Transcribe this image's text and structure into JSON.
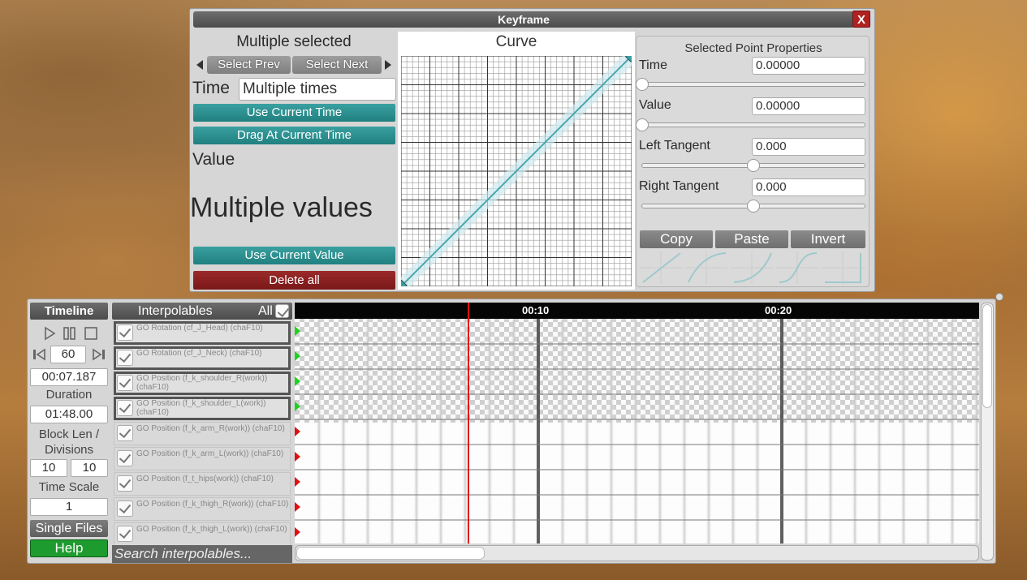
{
  "keyframe": {
    "title": "Keyframe",
    "close_label": "X",
    "multiple_selected": "Multiple selected",
    "select_prev": "Select Prev",
    "select_next": "Select Next",
    "time_label": "Time",
    "time_value": "Multiple times",
    "use_current_time": "Use Current Time",
    "drag_at_current_time": "Drag At Current Time",
    "value_label": "Value",
    "multiple_values": "Multiple values",
    "use_current_value": "Use Current Value",
    "delete_all": "Delete all",
    "curve_title": "Curve",
    "props": {
      "title": "Selected Point Properties",
      "time_label": "Time",
      "time_value": "0.00000",
      "time_slider": 0.0,
      "value_label": "Value",
      "value_value": "0.00000",
      "value_slider": 0.0,
      "left_tangent_label": "Left Tangent",
      "left_tangent_value": "0.000",
      "left_tangent_slider": 0.5,
      "right_tangent_label": "Right Tangent",
      "right_tangent_value": "0.000",
      "right_tangent_slider": 0.5,
      "copy": "Copy",
      "paste": "Paste",
      "invert": "Invert"
    }
  },
  "timeline": {
    "title": "Timeline",
    "play_icon": "play-icon",
    "pause_icon": "pause-icon",
    "stop_icon": "stop-icon",
    "fps": "60",
    "current_time": "00:07.187",
    "duration_label": "Duration",
    "duration": "01:48.00",
    "block_len_label": "Block Len / Divisions",
    "block_len": "10",
    "divisions": "10",
    "time_scale_label": "Time Scale",
    "time_scale": "1",
    "single_files": "Single Files",
    "help": "Help",
    "interpolables_header": "Interpolables",
    "all_label": "All",
    "search_placeholder": "Search interpolables...",
    "ruler_labels": [
      "00:10",
      "00:20"
    ],
    "interpolables": [
      {
        "name": "GO Rotation (cf_J_Head) (chaF10)",
        "selected": true,
        "marker": "green"
      },
      {
        "name": "GO Rotation (cf_J_Neck) (chaF10)",
        "selected": true,
        "marker": "green"
      },
      {
        "name": "GO Position (f_k_shoulder_R(work)) (chaF10)",
        "selected": true,
        "marker": "green"
      },
      {
        "name": "GO Position (f_k_shoulder_L(work)) (chaF10)",
        "selected": true,
        "marker": "green"
      },
      {
        "name": "GO Position (f_k_arm_R(work)) (chaF10)",
        "selected": false,
        "marker": "red"
      },
      {
        "name": "GO Position (f_k_arm_L(work)) (chaF10)",
        "selected": false,
        "marker": "red"
      },
      {
        "name": "GO Position (f_t_hips(work)) (chaF10)",
        "selected": false,
        "marker": "red"
      },
      {
        "name": "GO Position (f_k_thigh_R(work)) (chaF10)",
        "selected": false,
        "marker": "red"
      },
      {
        "name": "GO Position (f_k_thigh_L(work)) (chaF10)",
        "selected": false,
        "marker": "red"
      }
    ],
    "colors": {
      "accent_teal": "#2a8f8f",
      "delete_red": "#8b2020",
      "help_green": "#1e9b2e",
      "playhead": "#e01010"
    }
  }
}
